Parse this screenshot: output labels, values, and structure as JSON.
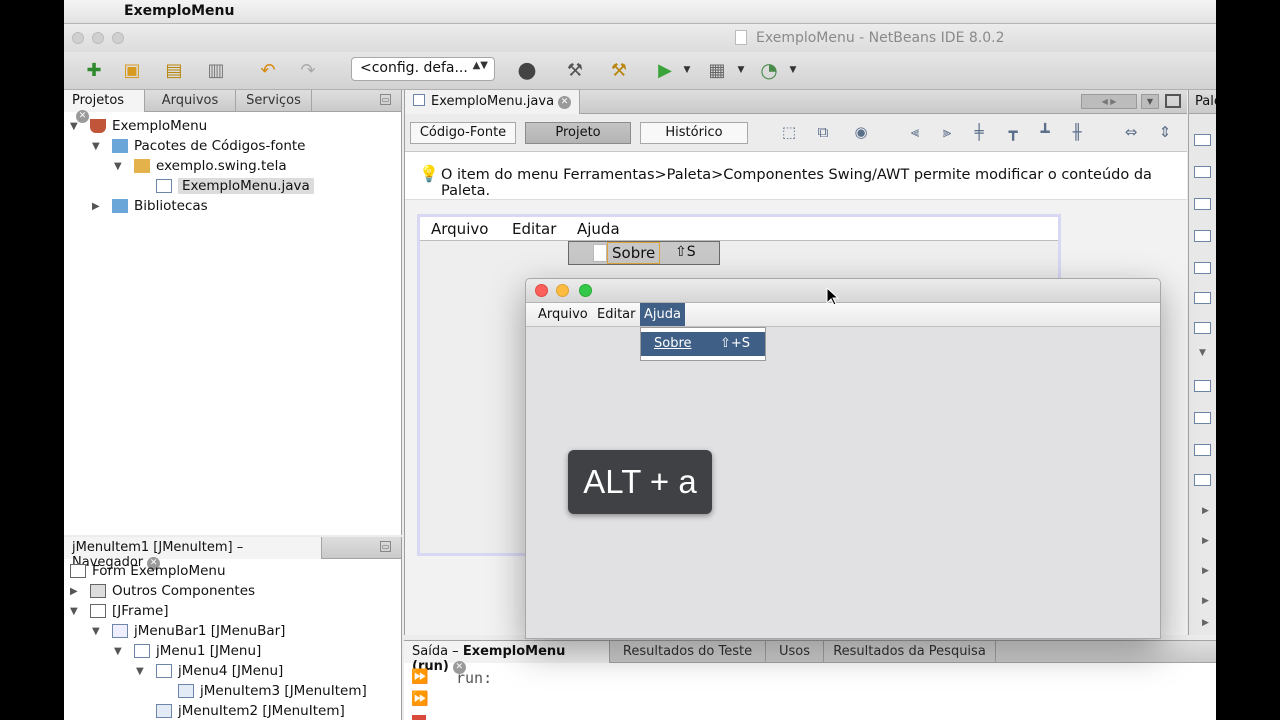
{
  "menubar": {
    "app_name": "ExemploMenu"
  },
  "window": {
    "title": "ExemploMenu - NetBeans IDE 8.0.2"
  },
  "toolbar": {
    "config_value": "<config. defa..."
  },
  "projects_panel": {
    "tabs": [
      {
        "label": "Projetos",
        "active": true
      },
      {
        "label": "Arquivos",
        "active": false
      },
      {
        "label": "Serviços",
        "active": false
      }
    ],
    "tree": [
      {
        "label": "ExemploMenu",
        "level": 0,
        "twisty": "▼",
        "icon": "coffee-cup-icon"
      },
      {
        "label": "Pacotes de Códigos-fonte",
        "level": 1,
        "twisty": "▼",
        "icon": "source-folder-icon"
      },
      {
        "label": "exemplo.swing.tela",
        "level": 2,
        "twisty": "▼",
        "icon": "package-icon"
      },
      {
        "label": "ExemploMenu.java",
        "level": 3,
        "twisty": "",
        "icon": "java-form-icon",
        "selected": true
      },
      {
        "label": "Bibliotecas",
        "level": 1,
        "twisty": "▶",
        "icon": "library-folder-icon"
      }
    ]
  },
  "navigator_panel": {
    "title": "jMenuItem1 [JMenuItem] – Navegador",
    "tree": [
      {
        "label": "Form ExemploMenu",
        "level": 0,
        "twisty": "",
        "icon": "form-icon"
      },
      {
        "label": "Outros Componentes",
        "level": 0,
        "twisty": "▶",
        "icon": "components-icon"
      },
      {
        "label": "[JFrame]",
        "level": 0,
        "twisty": "▼",
        "icon": "frame-icon"
      },
      {
        "label": "jMenuBar1 [JMenuBar]",
        "level": 1,
        "twisty": "▼",
        "icon": "menubar-icon"
      },
      {
        "label": "jMenu1 [JMenu]",
        "level": 2,
        "twisty": "▼",
        "icon": "menu-icon"
      },
      {
        "label": "jMenu4 [JMenu]",
        "level": 3,
        "twisty": "▼",
        "icon": "menu-icon"
      },
      {
        "label": "jMenuItem3 [JMenuItem]",
        "level": 4,
        "twisty": "",
        "icon": "menuitem-icon"
      },
      {
        "label": "jMenuItem2 [JMenuItem]",
        "level": 3,
        "twisty": "",
        "icon": "menuitem-icon"
      }
    ]
  },
  "editor": {
    "tab_label": "ExemploMenu.java",
    "views": [
      {
        "label": "Código-Fonte",
        "active": false
      },
      {
        "label": "Projeto",
        "active": true
      },
      {
        "label": "Histórico",
        "active": false
      }
    ],
    "hint": "O item do menu Ferramentas>Paleta>Componentes Swing/AWT permite modificar o conteúdo da Paleta.",
    "design_menus": [
      "Arquivo",
      "Editar",
      "Ajuda"
    ],
    "design_popup": {
      "label": "Sobre",
      "shortcut": "⇧S"
    }
  },
  "palette": {
    "tab_label": "Pale"
  },
  "output": {
    "tabs": [
      {
        "label": "Saída – ",
        "bold": "ExemploMenu (run)",
        "active": true
      },
      {
        "label": "Resultados do Teste"
      },
      {
        "label": "Usos"
      },
      {
        "label": "Resultados da Pesquisa"
      }
    ],
    "text": "run:"
  },
  "app_window": {
    "menus": [
      "Arquivo",
      "Editar",
      "Ajuda"
    ],
    "open_menu": "Ajuda",
    "popup_item": {
      "label": "Sobre",
      "shortcut": "⇧+S"
    }
  },
  "key_overlay": "ALT + a",
  "colors": {
    "accent": "#3f5f86",
    "selection_border": "#e0a43b",
    "design_frame": "#d8d8f4"
  }
}
